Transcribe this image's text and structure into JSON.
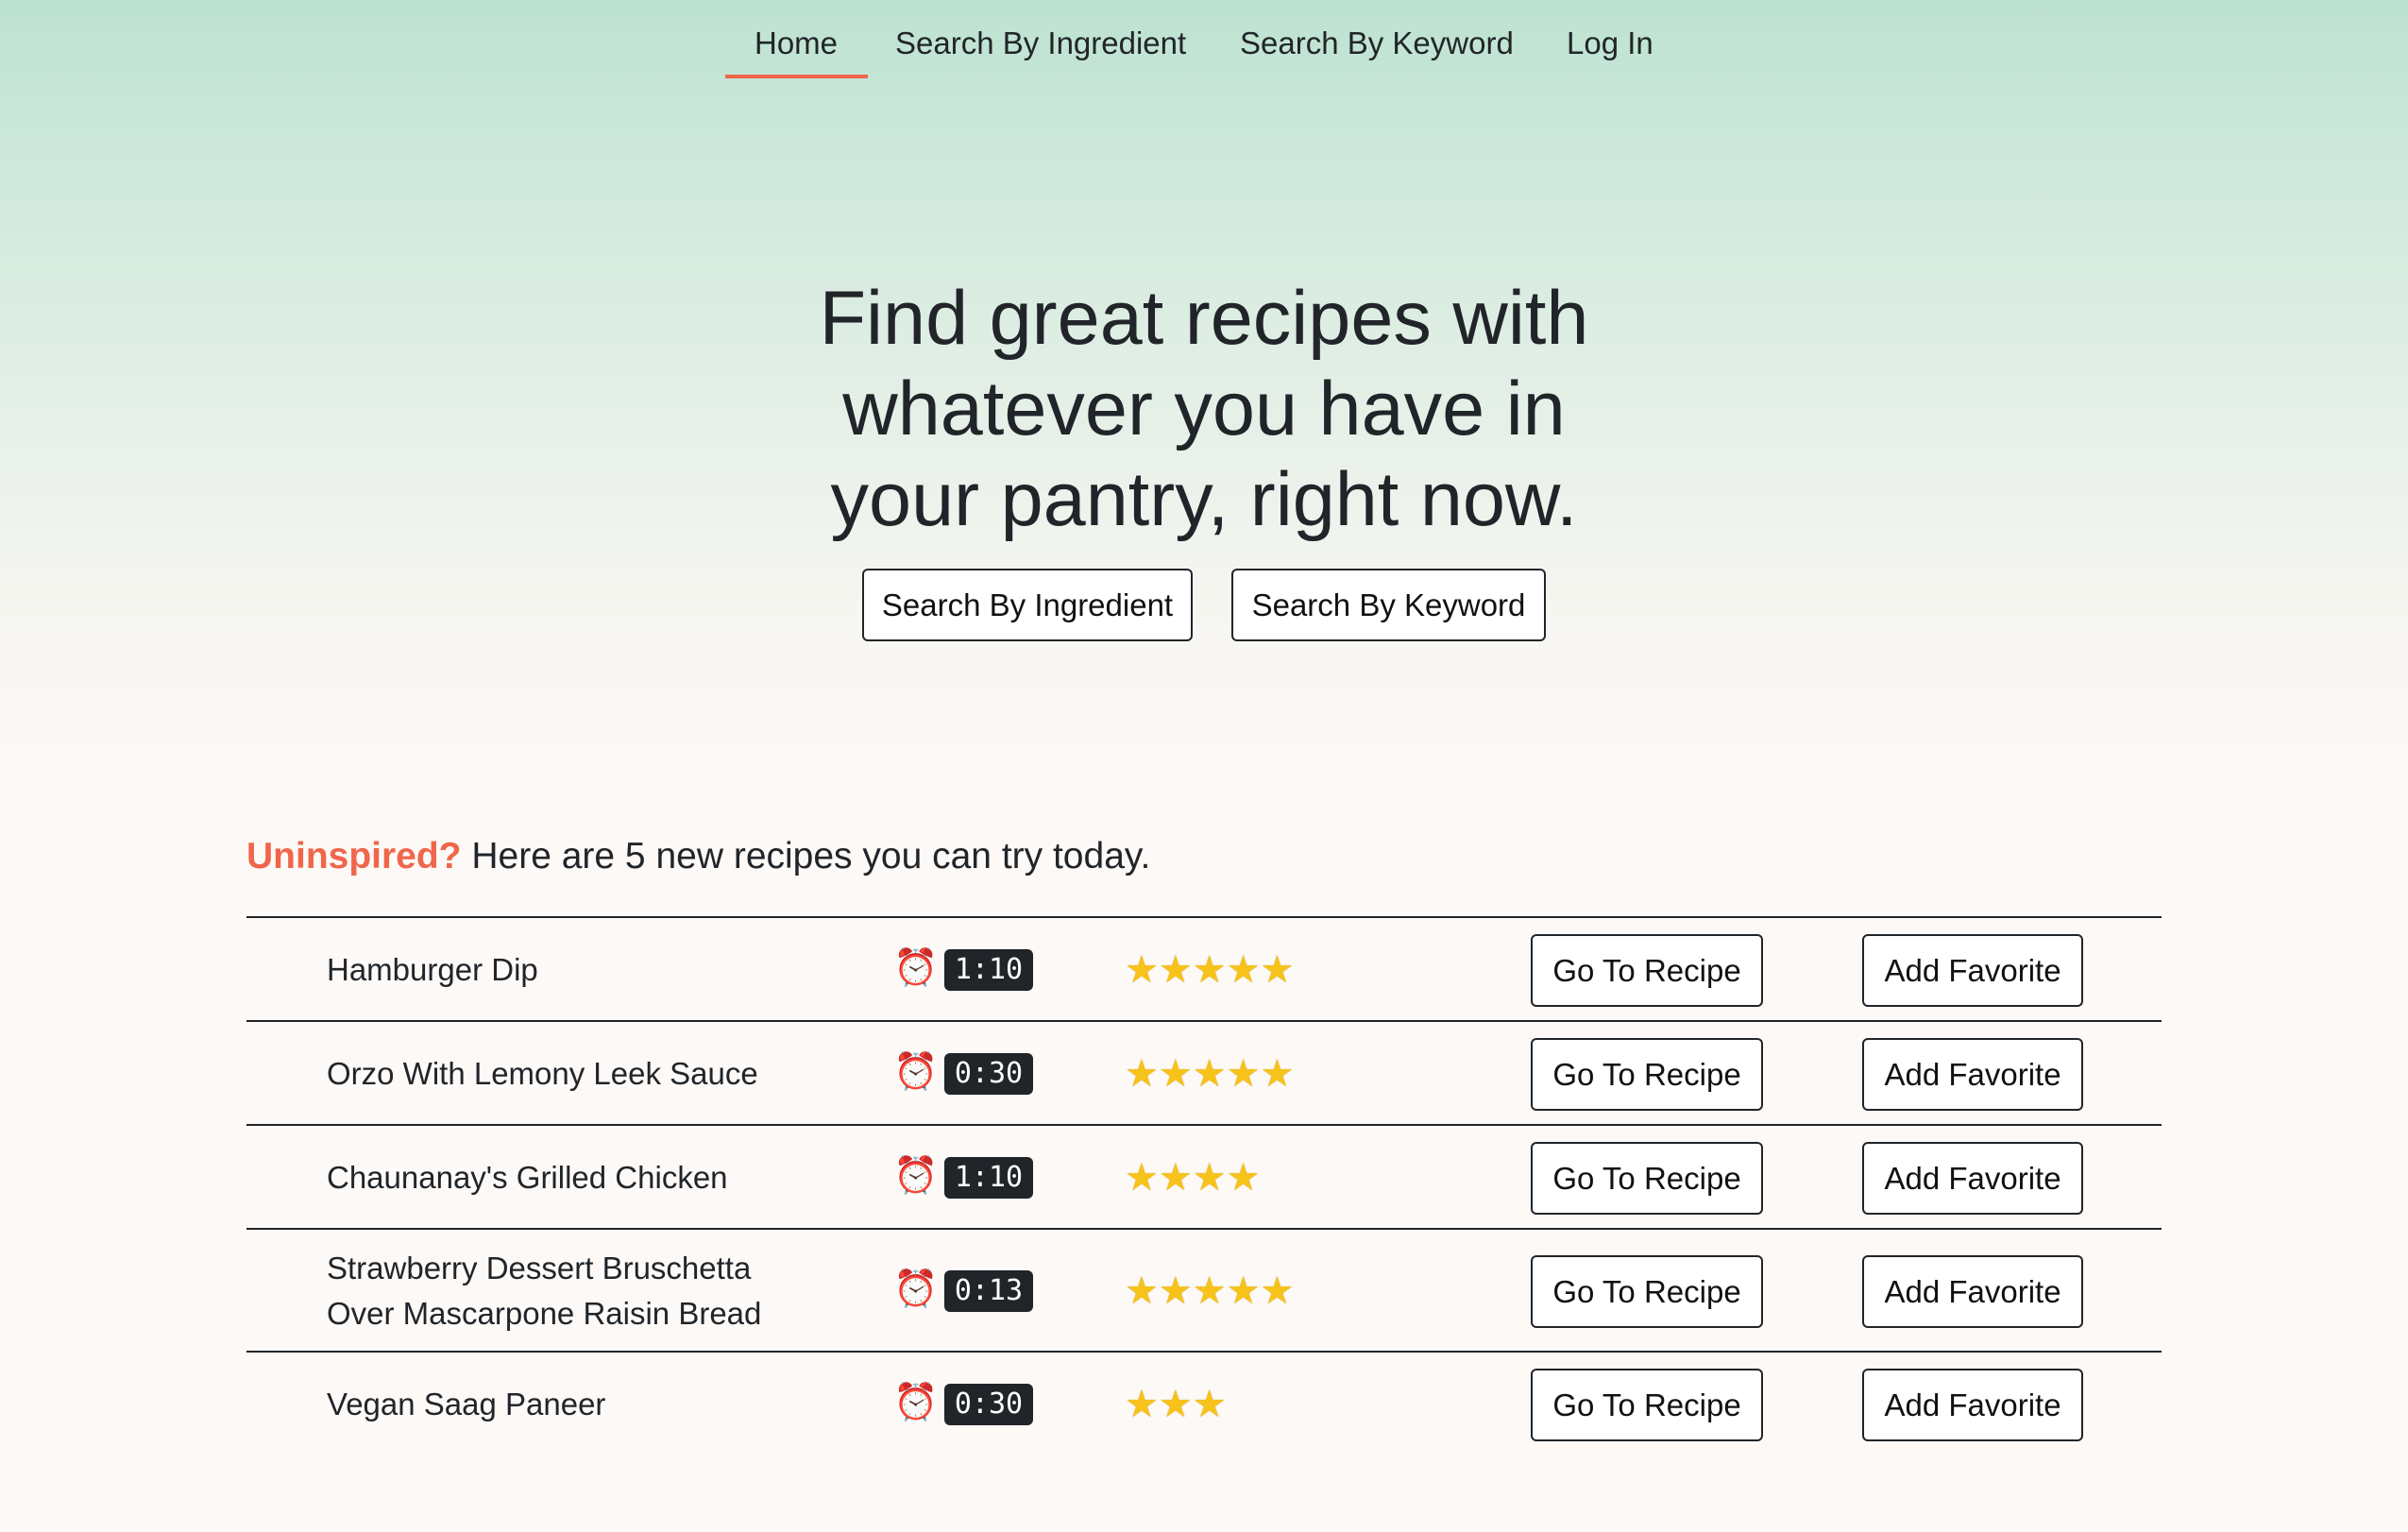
{
  "nav": {
    "items": [
      {
        "label": "Home",
        "active": true
      },
      {
        "label": "Search By Ingredient",
        "active": false
      },
      {
        "label": "Search By Keyword",
        "active": false
      },
      {
        "label": "Log In",
        "active": false
      }
    ]
  },
  "hero": {
    "title_lines": [
      "Find great recipes with",
      "whatever you have in",
      "your pantry, right now."
    ],
    "buttons": [
      "Search By Ingredient",
      "Search By Keyword"
    ]
  },
  "recipes_section": {
    "accent": "Uninspired?",
    "heading": " Here are 5 new recipes you can try today.",
    "go_label": "Go To Recipe",
    "fav_label": "Add Favorite",
    "clock_icon": "⏰",
    "star_glyph": "★",
    "items": [
      {
        "name_lines": [
          "Hamburger Dip"
        ],
        "time": "1:10",
        "rating": 5
      },
      {
        "name_lines": [
          "Orzo With Lemony Leek Sauce"
        ],
        "time": "0:30",
        "rating": 5
      },
      {
        "name_lines": [
          "Chaunanay's Grilled Chicken"
        ],
        "time": "1:10",
        "rating": 4
      },
      {
        "name_lines": [
          "Strawberry Dessert Bruschetta",
          "Over Mascarpone Raisin Bread"
        ],
        "time": "0:13",
        "rating": 5
      },
      {
        "name_lines": [
          "Vegan Saag Paneer"
        ],
        "time": "0:30",
        "rating": 3
      }
    ]
  },
  "colors": {
    "accent": "#f0664a",
    "text": "#212529",
    "badge_bg": "#212529",
    "star": "#f7c21a"
  },
  "icons": {
    "clock": "alarm-clock-icon",
    "star": "star-icon"
  }
}
